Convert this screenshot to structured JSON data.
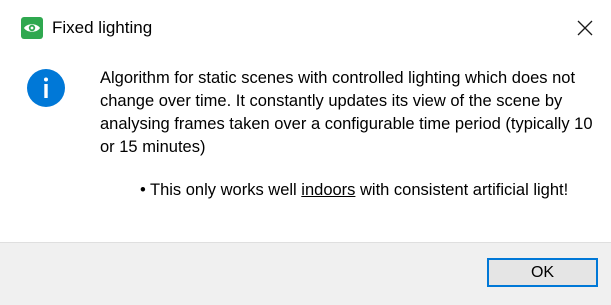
{
  "window": {
    "title": "Fixed lighting",
    "icon": "eye-app-icon",
    "close_icon": "close-icon"
  },
  "message": {
    "icon": "info-icon",
    "body": "Algorithm for static scenes with controlled lighting which does not change over time. It constantly updates its view of the scene by analysing frames taken over a configurable time period (typically 10 or 15 minutes)",
    "bullet_marker": "•",
    "bullet_before": "This only works well ",
    "bullet_emphasis": "indoors",
    "bullet_after": " with consistent artificial light!"
  },
  "buttons": {
    "ok_label": "OK"
  },
  "colors": {
    "info_blue": "#0078d7",
    "app_green": "#2fa84f",
    "footer_bg": "#f0f0f0",
    "focus_border": "#0078d7"
  }
}
